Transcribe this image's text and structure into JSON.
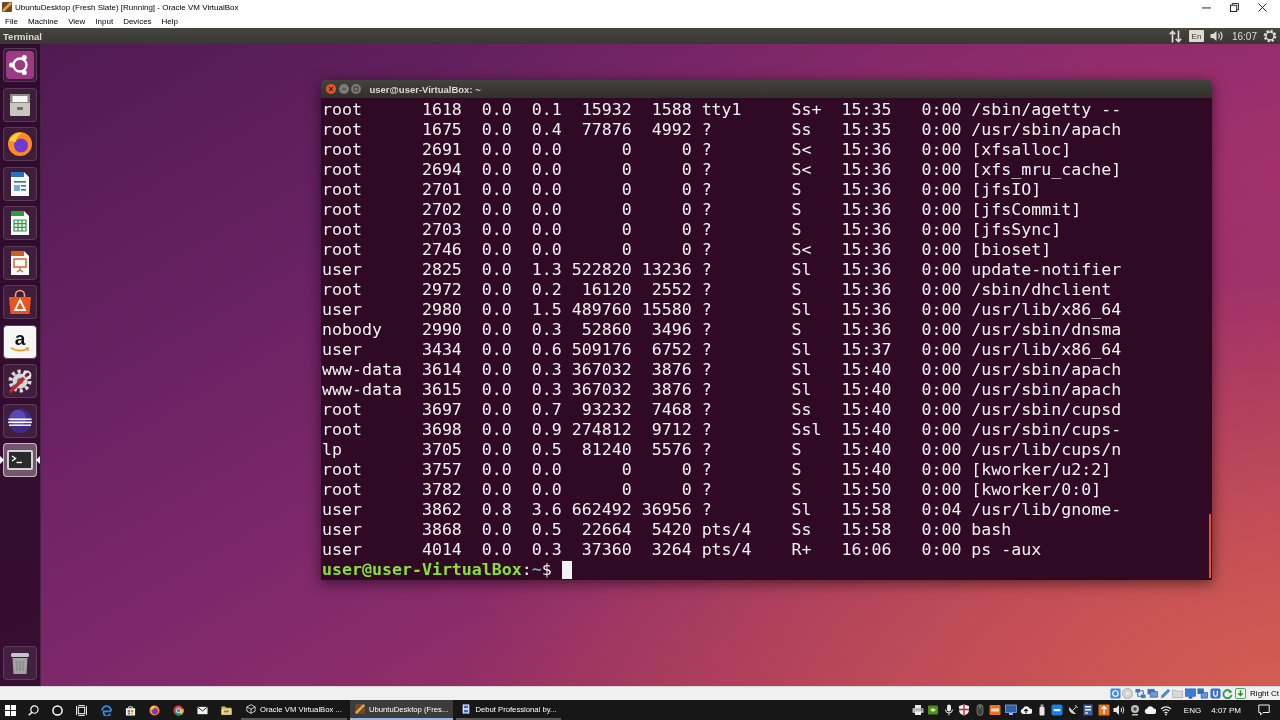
{
  "host_window": {
    "title": "UbuntuDesktop (Fresh Slate) [Running] - Oracle VM VirtualBox",
    "menu": [
      "File",
      "Machine",
      "View",
      "Input",
      "Devices",
      "Help"
    ]
  },
  "top_panel": {
    "app_name": "Terminal",
    "keyboard_layout": "En",
    "clock": "16:07"
  },
  "launcher": {
    "items": [
      {
        "selected": false
      },
      {
        "selected": false
      },
      {
        "selected": false
      },
      {
        "selected": false
      },
      {
        "selected": false
      },
      {
        "selected": false
      },
      {
        "selected": false
      },
      {
        "selected": false,
        "glyph": "a"
      },
      {
        "selected": false
      },
      {
        "selected": false
      },
      {
        "selected": true
      }
    ]
  },
  "terminal": {
    "title": "user@user-VirtualBox: ~",
    "lines": [
      "root      1618  0.0  0.1  15932  1588 tty1     Ss+  15:35   0:00 /sbin/agetty --",
      "root      1675  0.0  0.4  77876  4992 ?        Ss   15:35   0:00 /usr/sbin/apach",
      "root      2691  0.0  0.0      0     0 ?        S<   15:36   0:00 [xfsalloc]",
      "root      2694  0.0  0.0      0     0 ?        S<   15:36   0:00 [xfs_mru_cache]",
      "root      2701  0.0  0.0      0     0 ?        S    15:36   0:00 [jfsIO]",
      "root      2702  0.0  0.0      0     0 ?        S    15:36   0:00 [jfsCommit]",
      "root      2703  0.0  0.0      0     0 ?        S    15:36   0:00 [jfsSync]",
      "root      2746  0.0  0.0      0     0 ?        S<   15:36   0:00 [bioset]",
      "user      2825  0.0  1.3 522820 13236 ?        Sl   15:36   0:00 update-notifier",
      "root      2972  0.0  0.2  16120  2552 ?        S    15:36   0:00 /sbin/dhclient",
      "user      2980  0.0  1.5 489760 15580 ?        Sl   15:36   0:00 /usr/lib/x86_64",
      "nobody    2990  0.0  0.3  52860  3496 ?        S    15:36   0:00 /usr/sbin/dnsma",
      "user      3434  0.0  0.6 509176  6752 ?        Sl   15:37   0:00 /usr/lib/x86_64",
      "www-data  3614  0.0  0.3 367032  3876 ?        Sl   15:40   0:00 /usr/sbin/apach",
      "www-data  3615  0.0  0.3 367032  3876 ?        Sl   15:40   0:00 /usr/sbin/apach",
      "root      3697  0.0  0.7  93232  7468 ?        Ss   15:40   0:00 /usr/sbin/cupsd",
      "root      3698  0.0  0.9 274812  9712 ?        Ssl  15:40   0:00 /usr/sbin/cups-",
      "lp        3705  0.0  0.5  81240  5576 ?        S    15:40   0:00 /usr/lib/cups/n",
      "root      3757  0.0  0.0      0     0 ?        S    15:40   0:00 [kworker/u2:2]",
      "root      3782  0.0  0.0      0     0 ?        S    15:50   0:00 [kworker/0:0]",
      "user      3862  0.8  3.6 662492 36956 ?        Sl   15:58   0:04 /usr/lib/gnome-",
      "user      3868  0.0  0.5  22664  5420 pts/4    Ss   15:58   0:00 bash",
      "user      4014  0.0  0.3  37360  3264 pts/4    R+   16:06   0:00 ps -aux"
    ],
    "prompt": {
      "user_host": "user@user-VirtualBox",
      "separator": ":",
      "path": "~",
      "symbol": "$"
    }
  },
  "vm_status_bar": {
    "host_key": "Right Ct"
  },
  "taskbar": {
    "windows": [
      {
        "title": "Oracle VM VirtualBox ...",
        "selected": false
      },
      {
        "title": "UbuntuDesktop (Fres...",
        "selected": true
      },
      {
        "title": "Debut Professional by...",
        "selected": false
      }
    ],
    "language": "ENG",
    "clock": "4:07 PM"
  }
}
